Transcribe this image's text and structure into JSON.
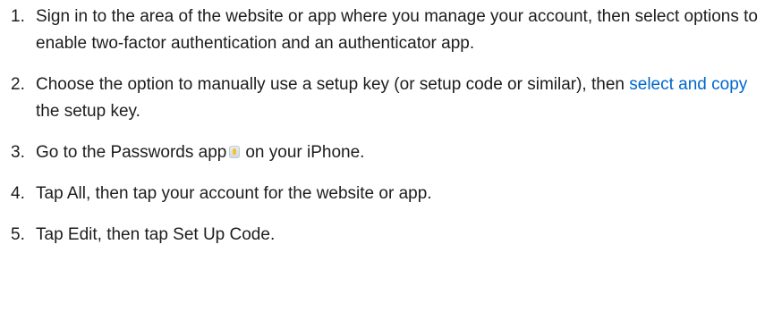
{
  "steps": [
    {
      "number": "1.",
      "text": "Sign in to the area of the website or app where you manage your account, then select options to enable two-factor authentication and an authenticator app."
    },
    {
      "number": "2.",
      "text_before": "Choose the option to manually use a setup key (or setup code or similar), then",
      "link": "select and copy",
      "text_after": "the setup key."
    },
    {
      "number": "3.",
      "text_before": "Go to the Passwords app",
      "icon": "passwords-app-icon",
      "text_after": "on your iPhone."
    },
    {
      "number": "4.",
      "text": "Tap All, then tap your account for the website or app."
    },
    {
      "number": "5.",
      "text": "Tap Edit, then tap Set Up Code."
    }
  ]
}
